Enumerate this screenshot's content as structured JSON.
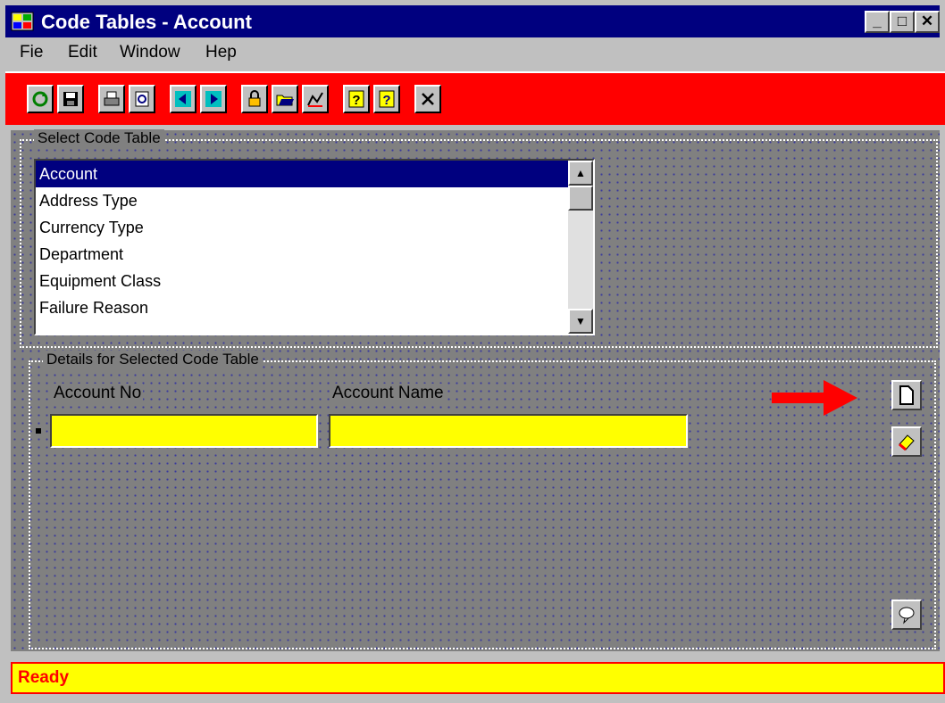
{
  "window": {
    "title": "Code Tables - Account",
    "minimize_glyph": "_",
    "maximize_glyph": "□",
    "close_glyph": "✕"
  },
  "menu": [
    {
      "label": "Fie"
    },
    {
      "label": "Edit"
    },
    {
      "label": "Window"
    },
    {
      "label": "Hep"
    }
  ],
  "toolbar": {
    "icons": [
      "refresh-icon",
      "save-icon",
      "print-icon",
      "print-preview-icon",
      "previous-icon",
      "next-icon",
      "lock-icon",
      "open-folder-icon",
      "chart-icon",
      "help-icon",
      "context-help-icon",
      "close-icon"
    ]
  },
  "select_group": {
    "title": "Select Code Table",
    "items": [
      "Account",
      "Address Type",
      "Currency Type",
      "Department",
      "Equipment Class",
      "Failure Reason"
    ],
    "selected": "Account"
  },
  "details_group": {
    "title": "Details for Selected Code Table",
    "columns": [
      "Account No",
      "Account Name"
    ],
    "row": {
      "account_no": "",
      "account_name": ""
    }
  },
  "colors": {
    "toolbar": "#ff0000",
    "titlebar": "#00007f",
    "field": "#ffff00",
    "arrow": "#ff0000"
  },
  "status": {
    "text": "Ready"
  }
}
